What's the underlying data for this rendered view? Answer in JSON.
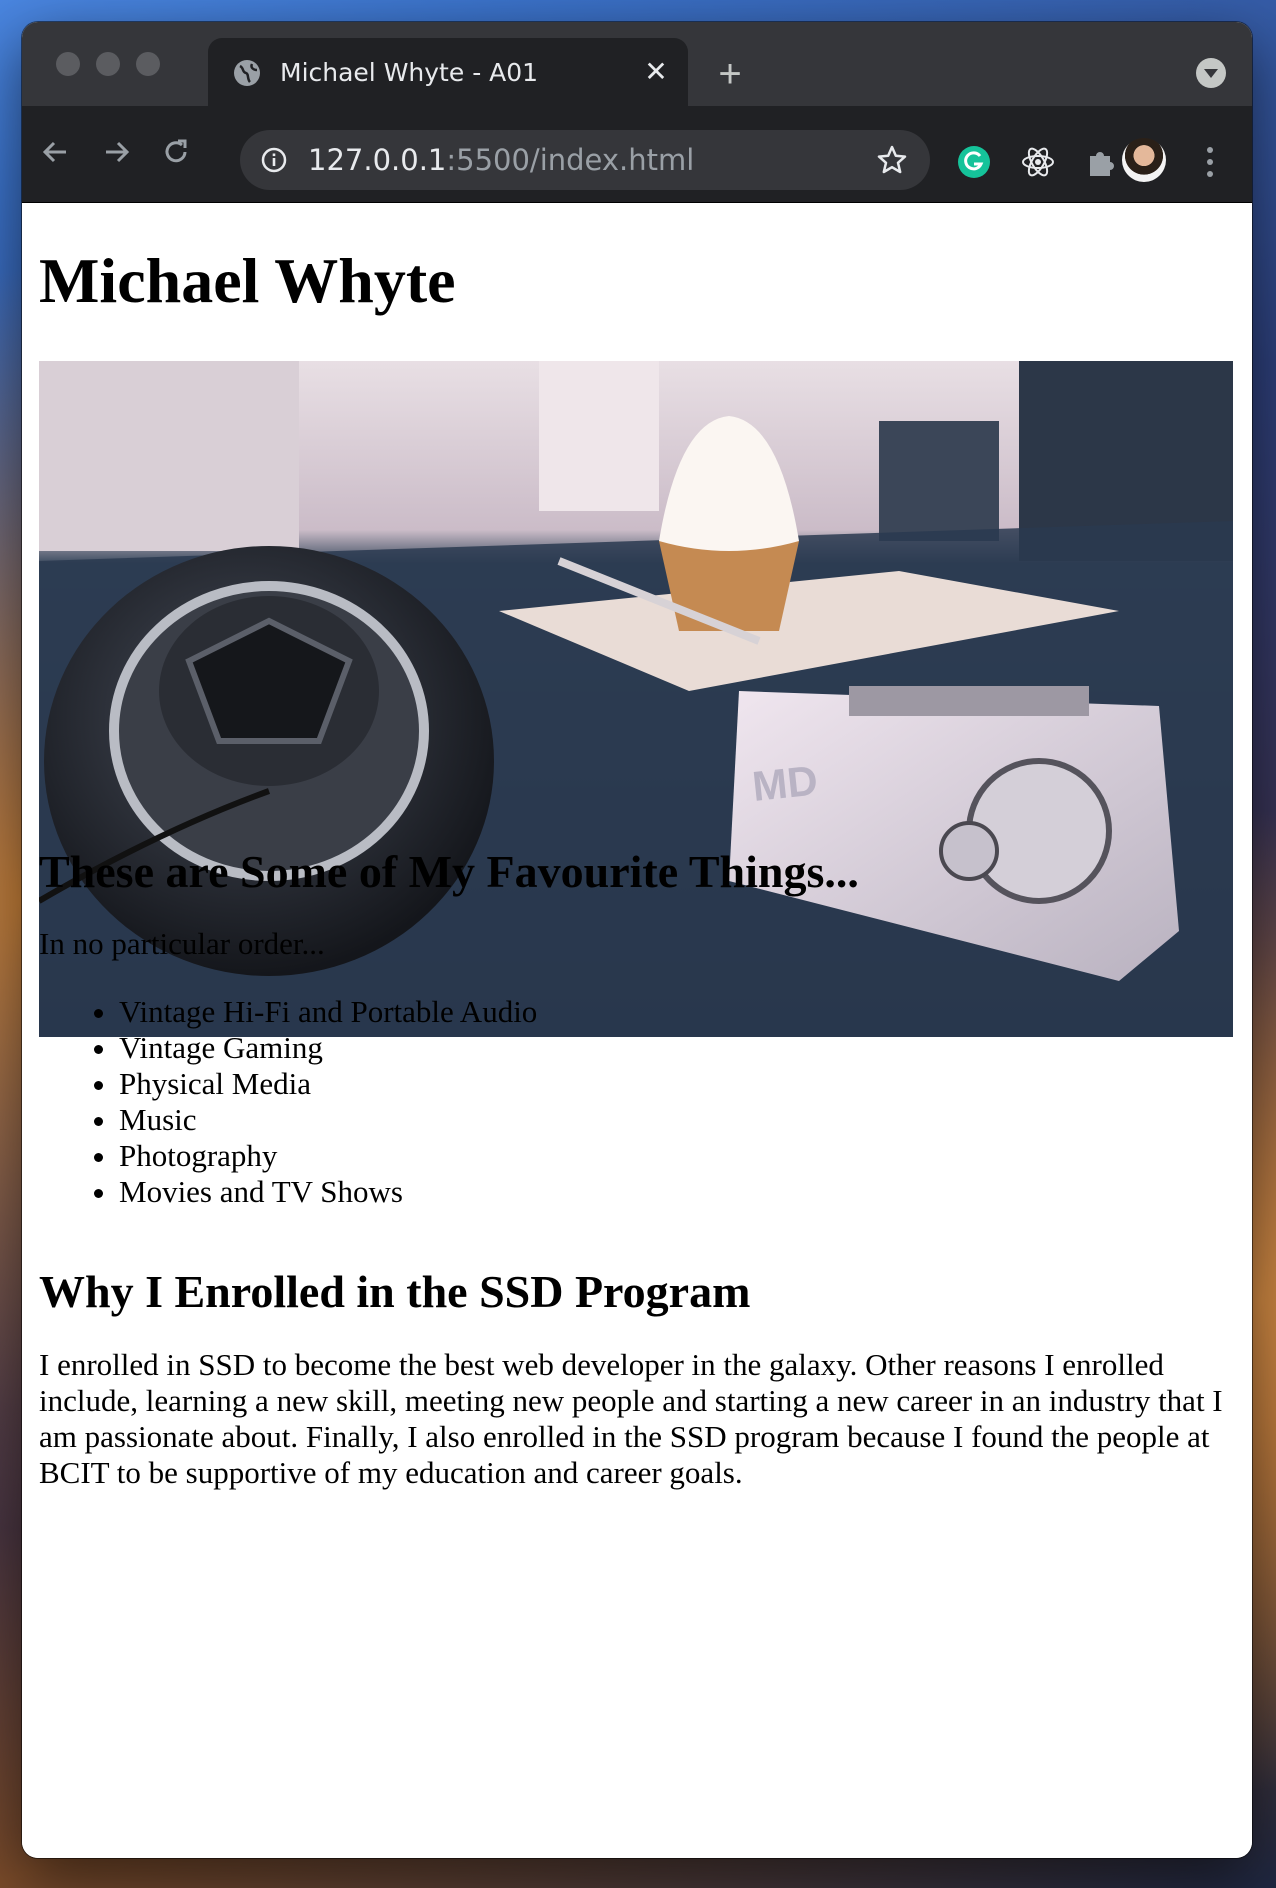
{
  "browser": {
    "tab_title": "Michael Whyte - A01",
    "url_host": "127.0.0.1",
    "url_rest": ":5500/index.html"
  },
  "page": {
    "heading": "Michael Whyte",
    "photo_description_icon": "photo",
    "favourites_heading": "These are Some of My Favourite Things...",
    "favourites_intro": "In no particular order...",
    "favourites": [
      "Vintage Hi-Fi and Portable Audio",
      "Vintage Gaming",
      "Physical Media",
      "Music",
      "Photography",
      "Movies and TV Shows"
    ],
    "ssd_heading": "Why I Enrolled in the SSD Program",
    "ssd_paragraph": "I enrolled in SSD to become the best web developer in the galaxy. Other reasons I enrolled include, learning a new skill, meeting new people and starting a new career in an industry that I am passionate about. Finally, I also enrolled in the SSD program because I found the people at BCIT to be supportive of my education and career goals."
  },
  "colors": {
    "chrome_dark": "#202124",
    "chrome_tabbar": "#35363a",
    "grammarly_green": "#15c39a"
  }
}
